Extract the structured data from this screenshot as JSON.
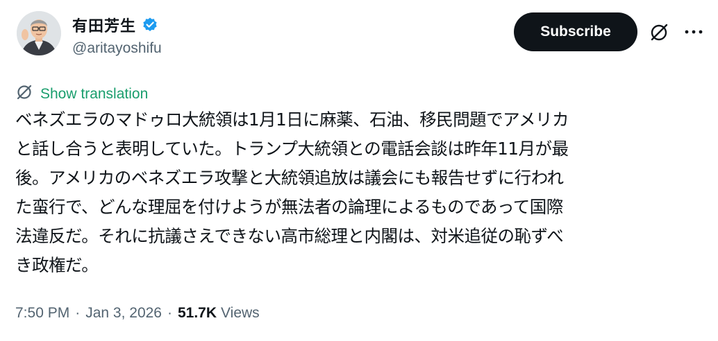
{
  "author": {
    "display_name": "有田芳生",
    "handle": "@aritayoshifu",
    "verified": true
  },
  "actions": {
    "subscribe_label": "Subscribe",
    "grok_icon": "grok-icon",
    "more_icon": "more-icon"
  },
  "translation": {
    "label": "Show translation",
    "color": "#1a9e6d"
  },
  "tweet": {
    "lines": [
      "ベネズエラのマドゥロ大統領は1月1日に麻薬、石油、移民問題でアメリカ",
      "と話し合うと表明していた。トランプ大統領との電話会談は昨年11月が最",
      "後。アメリカのベネズエラ攻撃と大統領追放は議会にも報告せずに行われ",
      "た蛮行で、どんな理屈を付けようが無法者の論理によるものであって国際",
      "法違反だ。それに抗議さえできない高市総理と内閣は、対米追従の恥ずべ",
      "き政権だ。"
    ]
  },
  "meta": {
    "time": "7:50 PM",
    "date": "Jan 3, 2026",
    "separator": "·",
    "views_count": "51.7K",
    "views_label": "Views"
  },
  "colors": {
    "text": "#0f1419",
    "secondary": "#536471",
    "verified": "#1d9bf0",
    "button_bg": "#0f1419"
  }
}
